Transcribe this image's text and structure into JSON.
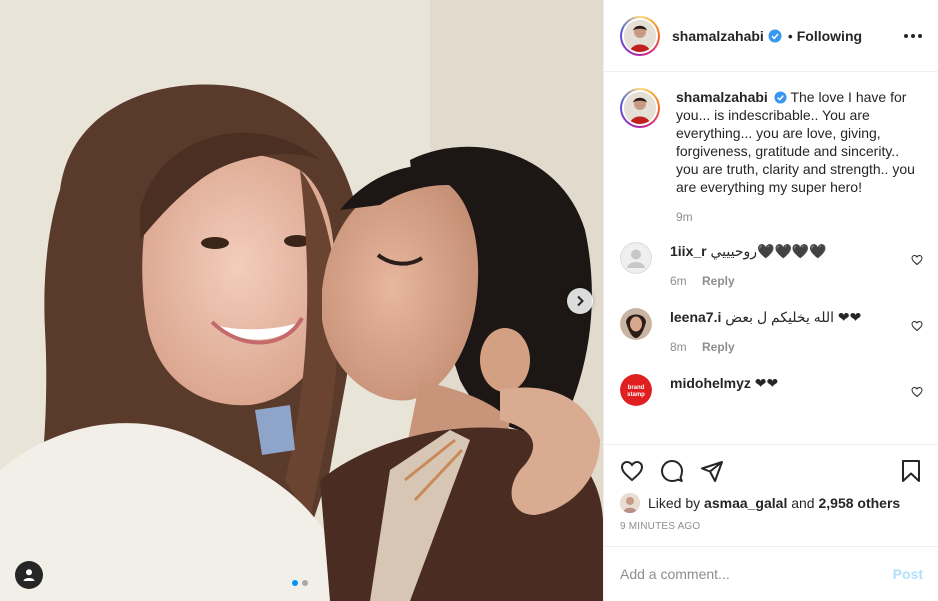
{
  "post": {
    "author": "shamalzahabi",
    "verified": true,
    "separator": "•",
    "follow_state": "Following",
    "carousel_pages": 2,
    "carousel_active": 1
  },
  "caption": {
    "username": "shamalzahabi",
    "text": "The love I have for you... is indescribable.. You are everything... you are love, giving, forgiveness, gratitude and sincerity.. you are truth, clarity and strength.. you are everything my super hero!",
    "time": "9m"
  },
  "comments": [
    {
      "username": "1iix_r",
      "text": "روحيييي🖤🖤🖤🖤",
      "time": "6m",
      "reply": "Reply",
      "avatar_color": "#e0e0e0"
    },
    {
      "username": "leena7.i",
      "text": "الله يخليكم ل بعض ❤❤",
      "time": "8m",
      "reply": "Reply",
      "avatar_color": "#8b6b5a"
    },
    {
      "username": "midohelmyz",
      "text": "❤❤",
      "time": "",
      "reply": "",
      "avatar_color": "#e02020",
      "avatar_text": "brand stamp"
    }
  ],
  "likes": {
    "prefix": "Liked by",
    "user": "asmaa_galal",
    "joiner": "and",
    "others": "2,958 others"
  },
  "timestamp": "9 MINUTES AGO",
  "add_comment": {
    "placeholder": "Add a comment...",
    "post_label": "Post"
  },
  "icons": {
    "like": "heart-icon",
    "comment": "comment-bubble-icon",
    "share": "paper-plane-icon",
    "save": "bookmark-icon",
    "more": "more-options-icon",
    "next": "chevron-right-icon",
    "tags": "user-tag-icon"
  },
  "colors": {
    "accent": "#0095f6",
    "verified": "#3897f0",
    "post_disabled": "#b2dffc",
    "muted": "#8e8e8e"
  }
}
